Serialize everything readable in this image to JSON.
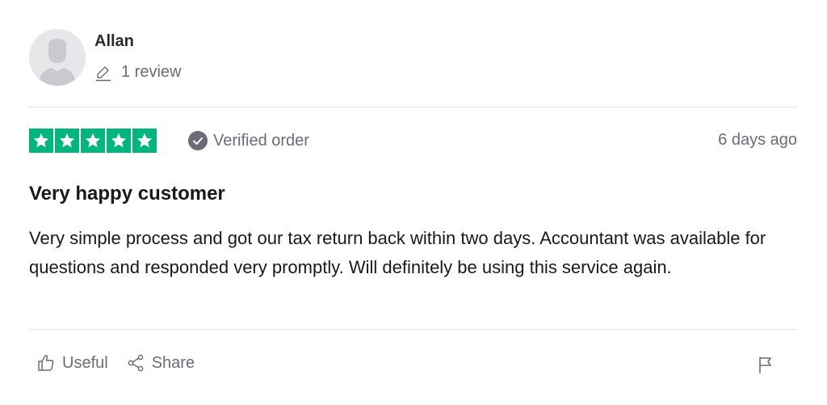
{
  "reviewer": {
    "name": "Allan",
    "review_count": "1 review"
  },
  "review": {
    "rating": 5,
    "rating_max": 5,
    "verified_label": "Verified order",
    "date": "6 days ago",
    "title": "Very happy customer",
    "text": "Very simple process and got our tax return back within two days. Accountant was available for questions and responded very promptly. Will definitely be using this service again."
  },
  "actions": {
    "useful_label": "Useful",
    "share_label": "Share"
  },
  "icons": {
    "avatar": "avatar-placeholder-icon",
    "review_count": "pencil-icon",
    "verified": "check-circle-icon",
    "useful": "thumbs-up-icon",
    "share": "share-icon",
    "report": "flag-icon"
  },
  "colors": {
    "star_green": "#00b67a",
    "muted_text": "#6b6b7a",
    "divider": "#e5e5e5"
  }
}
